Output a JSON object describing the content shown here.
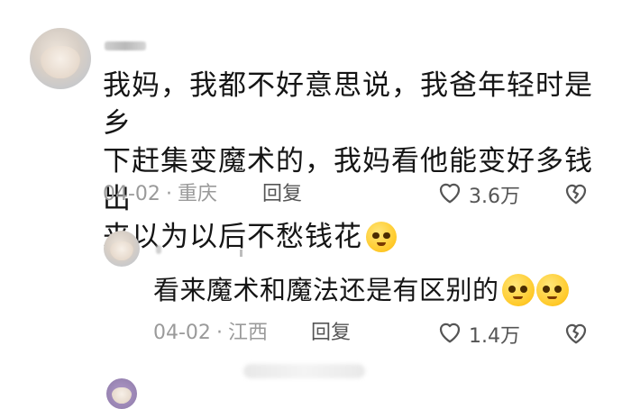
{
  "comment1": {
    "username": "",
    "text_line1": "我妈，我都不好意思说，我爸年轻时是乡",
    "text_line2": "下赶集变魔术的，我妈看他能变好多钱出",
    "text_line3": "来以为以后不愁钱花",
    "date": "04-02",
    "location": "重庆",
    "reply_label": "回复",
    "like_count": "3.6万",
    "like_icon": "heart-outline-icon",
    "dislike_icon": "broken-heart-icon",
    "emoji_icon": "smiling-emoji"
  },
  "reply1": {
    "username": "",
    "text": "看来魔术和魔法还是有区别的",
    "date": "04-02",
    "location": "江西",
    "reply_label": "回复",
    "like_count": "1.4万",
    "like_icon": "heart-outline-icon",
    "dislike_icon": "broken-heart-icon",
    "emoji_icon": "pleading-emoji"
  },
  "colors": {
    "text": "#151515",
    "meta": "#9a9a9a",
    "action": "#555555",
    "background": "#ffffff"
  }
}
